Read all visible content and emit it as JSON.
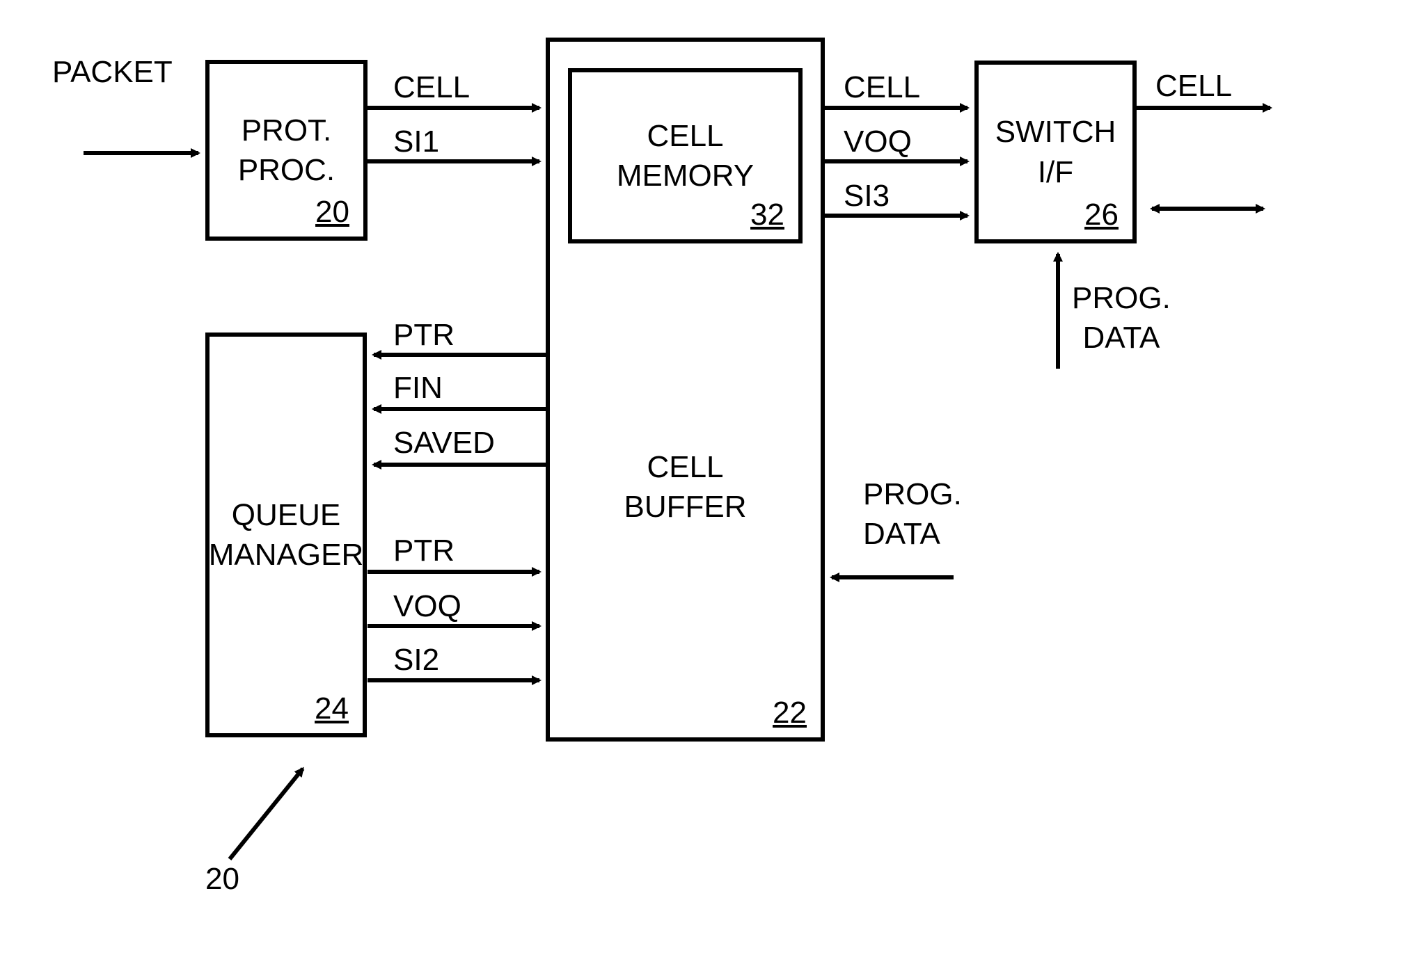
{
  "blocks": {
    "prot_proc": {
      "label_line1": "PROT.",
      "label_line2": "PROC.",
      "num": "20"
    },
    "queue_manager": {
      "label_line1": "QUEUE",
      "label_line2": "MANAGER",
      "num": "24"
    },
    "cell_buffer": {
      "label": "CELL\nBUFFER",
      "num": "22"
    },
    "cell_memory": {
      "label_line1": "CELL",
      "label_line2": "MEMORY",
      "num": "32"
    },
    "switch_if": {
      "label_line1": "SWITCH",
      "label_line2": "I/F",
      "num": "26"
    }
  },
  "labels": {
    "packet": "PACKET",
    "cell_pp_cb": "CELL",
    "si1": "SI1",
    "ptr_top": "PTR",
    "fin": "FIN",
    "saved": "SAVED",
    "ptr_bottom": "PTR",
    "voq_qm": "VOQ",
    "si2": "SI2",
    "cell_cb_sw": "CELL",
    "voq_sw": "VOQ",
    "si3": "SI3",
    "cell_out": "CELL",
    "prog_data_sw": "PROG.\nDATA",
    "prog_data_cb": "PROG.\nDATA",
    "fig_num": "20"
  }
}
